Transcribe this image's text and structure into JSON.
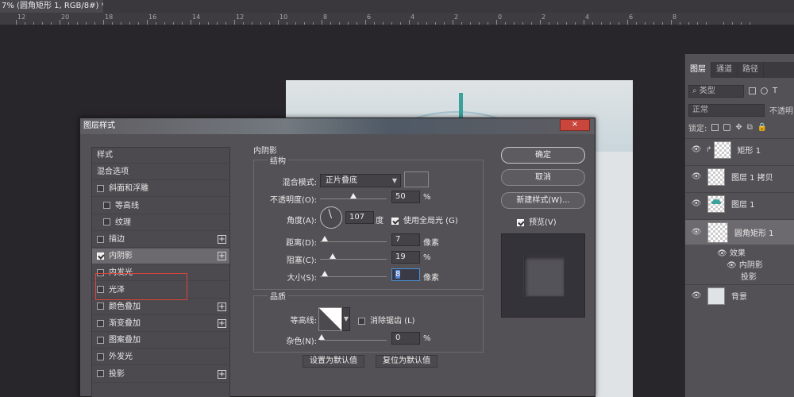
{
  "document": {
    "tab_title": "7% (圆角矩形 1, RGB/8#) *",
    "close_label": "×",
    "ruler_numbers": [
      "12",
      "20",
      "18",
      "16",
      "14",
      "12",
      "10",
      "8",
      "6",
      "4",
      "2",
      "0",
      "2",
      "4",
      "6",
      "8"
    ]
  },
  "layers_panel": {
    "tabs": [
      "图层",
      "通道",
      "路径"
    ],
    "filter_label": "类型",
    "blend_mode": "正常",
    "opacity_label": "不透明",
    "lock_label": "锁定:",
    "layers": [
      {
        "name": "矩形 1",
        "visible": true
      },
      {
        "name": "图层 1 拷贝",
        "visible": true
      },
      {
        "name": "图层 1",
        "visible": true
      },
      {
        "name": "圆角矩形 1",
        "visible": true,
        "selected": true
      },
      {
        "name": "背景",
        "visible": true
      }
    ],
    "effects_label": "效果",
    "effects": [
      "内阴影",
      "投影"
    ],
    "eye_glyph": "👁"
  },
  "dialog": {
    "title": "图层样式",
    "close_label": "×",
    "style_list": [
      {
        "label": "样式",
        "checkbox": false,
        "plus": false
      },
      {
        "label": "混合选项",
        "checkbox": false,
        "plus": false
      },
      {
        "label": "斜面和浮雕",
        "checkbox": true,
        "checked": false,
        "plus": false
      },
      {
        "label": "等高线",
        "checkbox": true,
        "checked": false,
        "plus": false,
        "indent": true
      },
      {
        "label": "纹理",
        "checkbox": true,
        "checked": false,
        "plus": false,
        "indent": true
      },
      {
        "label": "描边",
        "checkbox": true,
        "checked": false,
        "plus": true
      },
      {
        "label": "内阴影",
        "checkbox": true,
        "checked": true,
        "plus": true,
        "selected": true
      },
      {
        "label": "内发光",
        "checkbox": true,
        "checked": false,
        "plus": false
      },
      {
        "label": "光泽",
        "checkbox": true,
        "checked": false,
        "plus": false
      },
      {
        "label": "颜色叠加",
        "checkbox": true,
        "checked": false,
        "plus": true
      },
      {
        "label": "渐变叠加",
        "checkbox": true,
        "checked": false,
        "plus": true
      },
      {
        "label": "图案叠加",
        "checkbox": true,
        "checked": false,
        "plus": false
      },
      {
        "label": "外发光",
        "checkbox": true,
        "checked": false,
        "plus": false
      },
      {
        "label": "投影",
        "checkbox": true,
        "checked": false,
        "plus": true
      }
    ],
    "section_title": "内阴影",
    "structure": {
      "legend": "结构",
      "blend_label": "混合模式:",
      "blend_value": "正片叠底",
      "opacity_label": "不透明度(O):",
      "opacity_value": "50",
      "opacity_unit": "%",
      "opacity_level": 0.5,
      "angle_label": "角度(A):",
      "angle_value": "107",
      "angle_unit": "度",
      "global_light_label": "使用全局光 (G)",
      "global_light_checked": true,
      "distance_label": "距离(D):",
      "distance_value": "7",
      "distance_unit": "像素",
      "choke_label": "阻塞(C):",
      "choke_value": "19",
      "choke_unit": "%",
      "size_label": "大小(S):",
      "size_value": "8",
      "size_unit": "像素",
      "color": "#555358"
    },
    "quality": {
      "legend": "品质",
      "contour_label": "等高线:",
      "antialias_label": "消除锯齿 (L)",
      "antialias_checked": false,
      "noise_label": "杂色(N):",
      "noise_value": "0",
      "noise_unit": "%"
    },
    "set_default_label": "设置为默认值",
    "reset_default_label": "复位为默认值",
    "ok_label": "确定",
    "cancel_label": "取消",
    "new_style_label": "新建样式(W)...",
    "preview_label": "预览(V)",
    "preview_checked": true
  },
  "colors": {
    "accent": "#3aa29a",
    "selection_outline": "#d8473c",
    "close_button": "#c9463d"
  }
}
